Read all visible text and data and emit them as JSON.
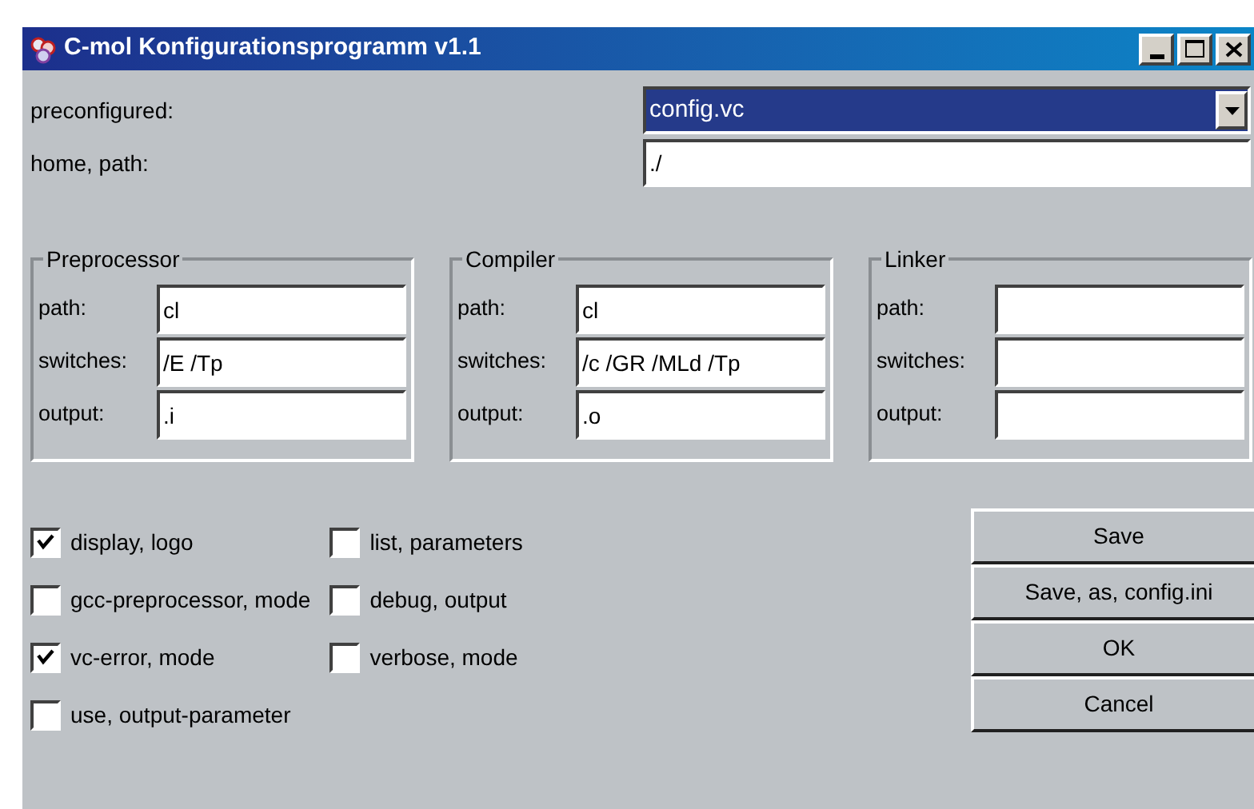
{
  "window": {
    "title": "C-mol Konfigurationsprogramm v1.1"
  },
  "preconfigured": {
    "label": "preconfigured:",
    "value": "config.vc"
  },
  "home_path": {
    "label": "home, path:",
    "value": "./"
  },
  "groups": [
    {
      "title": "Preprocessor",
      "fields": [
        {
          "label": "path:",
          "value": "cl"
        },
        {
          "label": "switches:",
          "value": "/E /Tp"
        },
        {
          "label": "output:",
          "value": ".i"
        }
      ]
    },
    {
      "title": "Compiler",
      "fields": [
        {
          "label": "path:",
          "value": "cl"
        },
        {
          "label": "switches:",
          "value": "/c /GR /MLd /Tp"
        },
        {
          "label": "output:",
          "value": ".o"
        }
      ]
    },
    {
      "title": "Linker",
      "fields": [
        {
          "label": "path:"
        },
        {
          "label": "switches:"
        },
        {
          "label": "output:"
        }
      ]
    }
  ],
  "options": [
    [
      {
        "label": "display, logo",
        "checked": true
      },
      {
        "label": "gcc-preprocessor, mode",
        "checked": false
      },
      {
        "label": "vc-error, mode",
        "checked": true
      },
      {
        "label": "use, output-parameter",
        "checked": false
      }
    ],
    [
      {
        "label": "list, parameters",
        "checked": false
      },
      {
        "label": "debug, output",
        "checked": false
      },
      {
        "label": "verbose, mode",
        "checked": false
      }
    ]
  ],
  "buttons": [
    "Save",
    "Save, as, config.ini",
    "OK",
    "Cancel"
  ]
}
